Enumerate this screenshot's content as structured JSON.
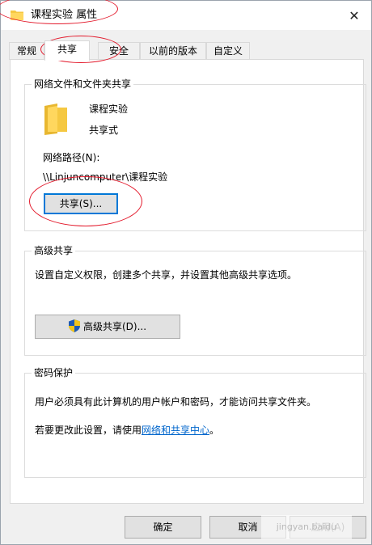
{
  "window": {
    "title": "课程实验 属性",
    "close_glyph": "✕"
  },
  "tabs": [
    {
      "label": "常规",
      "active": false
    },
    {
      "label": "共享",
      "active": true
    },
    {
      "label": "安全",
      "active": false
    },
    {
      "label": "以前的版本",
      "active": false
    },
    {
      "label": "自定义",
      "active": false
    }
  ],
  "network_share": {
    "group_title": "网络文件和文件夹共享",
    "folder_name": "课程实验",
    "share_state": "共享式",
    "path_label": "网络路径(N):",
    "path_value": "\\\\Linjuncomputer\\课程实验",
    "share_button": "共享(S)..."
  },
  "advanced_share": {
    "group_title": "高级共享",
    "description": "设置自定义权限，创建多个共享，并设置其他高级共享选项。",
    "button": "高级共享(D)..."
  },
  "password_protect": {
    "group_title": "密码保护",
    "description": "用户必须具有此计算机的用户帐户和密码，才能访问共享文件夹。",
    "change_prefix": "若要更改此设置，请使用",
    "link_text": "网络和共享中心",
    "change_suffix": "。"
  },
  "footer": {
    "ok": "确定",
    "cancel": "取消",
    "apply": "应用(A)"
  },
  "watermark": "jingyan.baidu",
  "colors": {
    "accent": "#0078d7",
    "link": "#0066cc",
    "annotation": "#e3192b",
    "folder": "#f5c842"
  }
}
